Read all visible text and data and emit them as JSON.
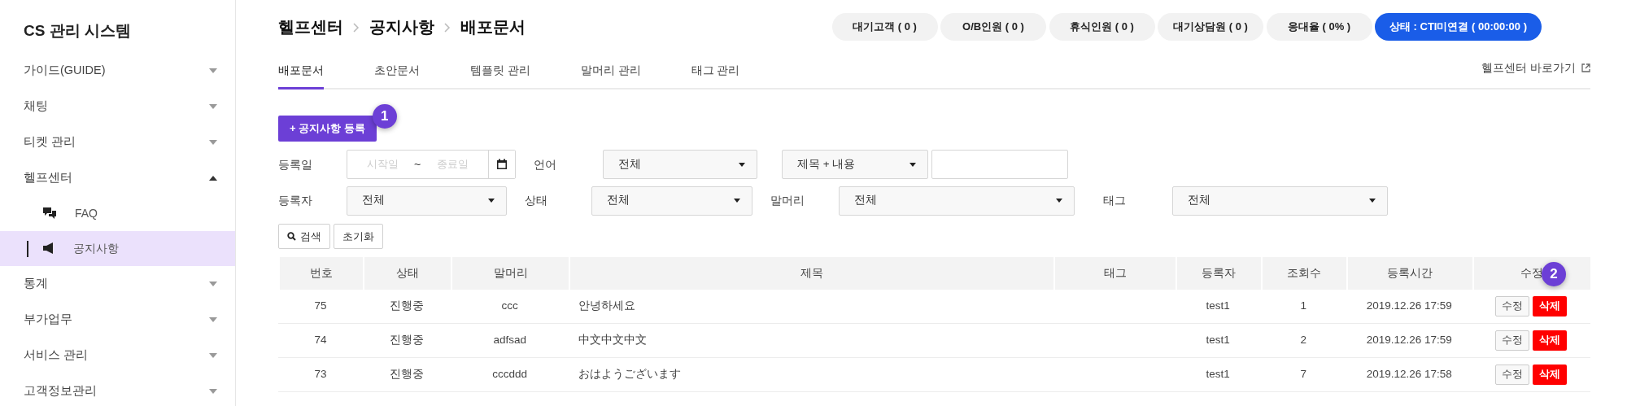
{
  "sidebar": {
    "title": "CS 관리 시스템",
    "items": [
      {
        "label": "가이드(GUIDE)",
        "expanded": false
      },
      {
        "label": "채팅",
        "expanded": false
      },
      {
        "label": "티켓 관리",
        "expanded": false
      },
      {
        "label": "헬프센터",
        "expanded": true,
        "children": [
          {
            "label": "FAQ",
            "kind": "faq",
            "selected": false
          },
          {
            "label": "공지사항",
            "kind": "notice",
            "selected": true
          }
        ]
      },
      {
        "label": "통계",
        "expanded": false
      },
      {
        "label": "부가업무",
        "expanded": false
      },
      {
        "label": "서비스 관리",
        "expanded": false
      },
      {
        "label": "고객정보관리",
        "expanded": false
      }
    ]
  },
  "breadcrumb": [
    "헬프센터",
    "공지사항",
    "배포문서"
  ],
  "status_pills": [
    {
      "label": "대기고객 ( 0 )",
      "highlighted": false
    },
    {
      "label": "O/B인원 ( 0 )",
      "highlighted": false
    },
    {
      "label": "휴식인원 ( 0 )",
      "highlighted": false
    },
    {
      "label": "대기상담원 ( 0 )",
      "highlighted": false
    },
    {
      "label": "응대율 ( 0% )",
      "highlighted": false
    },
    {
      "label": "상태 : CTI미연결 ( 00:00:00 )",
      "highlighted": true
    }
  ],
  "tabs": [
    {
      "label": "배포문서",
      "selected": true
    },
    {
      "label": "초안문서",
      "selected": false
    },
    {
      "label": "템플릿 관리",
      "selected": false
    },
    {
      "label": "말머리 관리",
      "selected": false
    },
    {
      "label": "태그 관리",
      "selected": false
    }
  ],
  "help_link": "헬프센터 바로가기",
  "register_button": {
    "icon": "+",
    "label": "공지사항 등록",
    "badge": "1"
  },
  "filters": {
    "date_label": "등록일",
    "start_placeholder": "시작일",
    "separator": "~",
    "end_placeholder": "종료일",
    "language_label": "언어",
    "language": "전체",
    "search_scope": "제목 + 내용",
    "author_label": "등록자",
    "author": "전체",
    "status_label": "상태",
    "status": "전체",
    "prefix_label": "말머리",
    "prefix": "전체",
    "tag_label": "태그",
    "tag": "전체"
  },
  "search_button": "검색",
  "reset_button": "초기화",
  "table": {
    "columns": [
      "번호",
      "상태",
      "말머리",
      "제목",
      "태그",
      "등록자",
      "조회수",
      "등록시간",
      "수정"
    ],
    "edit_badge": "2",
    "rows": [
      {
        "cells": [
          "75",
          "진행중",
          "ccc",
          "안녕하세요",
          "",
          "test1",
          "1",
          "2019.12.26 17:59"
        ],
        "edit": "수정",
        "delete": "삭제"
      },
      {
        "cells": [
          "74",
          "진행중",
          "adfsad",
          "中文中文中文",
          "",
          "test1",
          "2",
          "2019.12.26 17:59"
        ],
        "edit": "수정",
        "delete": "삭제"
      },
      {
        "cells": [
          "73",
          "진행중",
          "cccddd",
          "おはようございます",
          "",
          "test1",
          "7",
          "2019.12.26 17:58"
        ],
        "edit": "수정",
        "delete": "삭제"
      }
    ]
  }
}
